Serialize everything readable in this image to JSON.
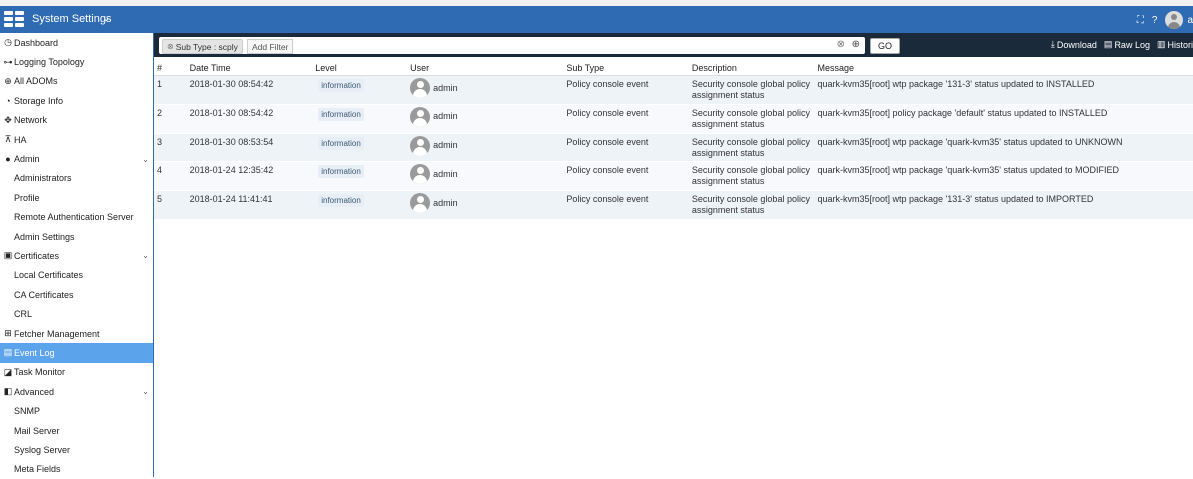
{
  "header": {
    "title": "System Settings",
    "partial_label": "a"
  },
  "sidebar": {
    "items": [
      {
        "label": "Dashboard",
        "icon": "dashboard-icon",
        "level": "top",
        "glyph": "◷"
      },
      {
        "label": "Logging Topology",
        "icon": "topology-icon",
        "level": "top",
        "glyph": "⊶"
      },
      {
        "label": "All ADOMs",
        "icon": "globe-icon",
        "level": "top",
        "glyph": "⊕"
      },
      {
        "label": "Storage Info",
        "icon": "storage-icon",
        "level": "top",
        "glyph": "◔"
      },
      {
        "label": "Network",
        "icon": "network-icon",
        "level": "top",
        "glyph": "✥"
      },
      {
        "label": "HA",
        "icon": "ha-icon",
        "level": "top",
        "glyph": "⊼"
      },
      {
        "label": "Admin",
        "icon": "user-icon",
        "level": "top",
        "glyph": "●",
        "expanded": true
      },
      {
        "label": "Administrators",
        "level": "sub"
      },
      {
        "label": "Profile",
        "level": "sub"
      },
      {
        "label": "Remote Authentication Server",
        "level": "sub"
      },
      {
        "label": "Admin Settings",
        "level": "sub"
      },
      {
        "label": "Certificates",
        "icon": "certificate-icon",
        "level": "top",
        "glyph": "▣",
        "expanded": true
      },
      {
        "label": "Local Certificates",
        "level": "sub"
      },
      {
        "label": "CA Certificates",
        "level": "sub"
      },
      {
        "label": "CRL",
        "level": "sub"
      },
      {
        "label": "Fetcher Management",
        "icon": "fetcher-icon",
        "level": "top",
        "glyph": "⊞"
      },
      {
        "label": "Event Log",
        "icon": "event-log-icon",
        "level": "top",
        "glyph": "▤",
        "active": true
      },
      {
        "label": "Task Monitor",
        "icon": "task-monitor-icon",
        "level": "top",
        "glyph": "◪"
      },
      {
        "label": "Advanced",
        "icon": "advanced-icon",
        "level": "top",
        "glyph": "◧",
        "expanded": true
      },
      {
        "label": "SNMP",
        "level": "sub"
      },
      {
        "label": "Mail Server",
        "level": "sub"
      },
      {
        "label": "Syslog Server",
        "level": "sub"
      },
      {
        "label": "Meta Fields",
        "level": "sub"
      }
    ]
  },
  "filter": {
    "chip": "Sub Type : scply",
    "add_filter": "Add Filter",
    "go": "GO"
  },
  "actions": {
    "download": "Download",
    "raw_log": "Raw Log",
    "history": "Histori"
  },
  "table": {
    "columns": [
      "#",
      "Date Time",
      "Level",
      "User",
      "Sub Type",
      "Description",
      "Message"
    ],
    "rows": [
      {
        "idx": "1",
        "datetime": "2018-01-30 08:54:42",
        "level": "information",
        "user": "admin",
        "subtype": "Policy console event",
        "description": "Security console global policy assignment status",
        "message": "quark-kvm35[root] wtp package '131-3' status updated to INSTALLED"
      },
      {
        "idx": "2",
        "datetime": "2018-01-30 08:54:42",
        "level": "information",
        "user": "admin",
        "subtype": "Policy console event",
        "description": "Security console global policy assignment status",
        "message": "quark-kvm35[root] policy package 'default' status updated to INSTALLED"
      },
      {
        "idx": "3",
        "datetime": "2018-01-30 08:53:54",
        "level": "information",
        "user": "admin",
        "subtype": "Policy console event",
        "description": "Security console global policy assignment status",
        "message": "quark-kvm35[root] wtp package 'quark-kvm35' status updated to UNKNOWN"
      },
      {
        "idx": "4",
        "datetime": "2018-01-24 12:35:42",
        "level": "information",
        "user": "admin",
        "subtype": "Policy console event",
        "description": "Security console global policy assignment status",
        "message": "quark-kvm35[root] wtp package 'quark-kvm35' status updated to MODIFIED"
      },
      {
        "idx": "5",
        "datetime": "2018-01-24 11:41:41",
        "level": "information",
        "user": "admin",
        "subtype": "Policy console event",
        "description": "Security console global policy assignment status",
        "message": "quark-kvm35[root] wtp package '131-3' status updated to IMPORTED"
      }
    ]
  },
  "colors": {
    "header_bg": "#2f6bb3",
    "filterbar_bg": "#1b2a3a",
    "active_nav": "#5ba3ea"
  }
}
